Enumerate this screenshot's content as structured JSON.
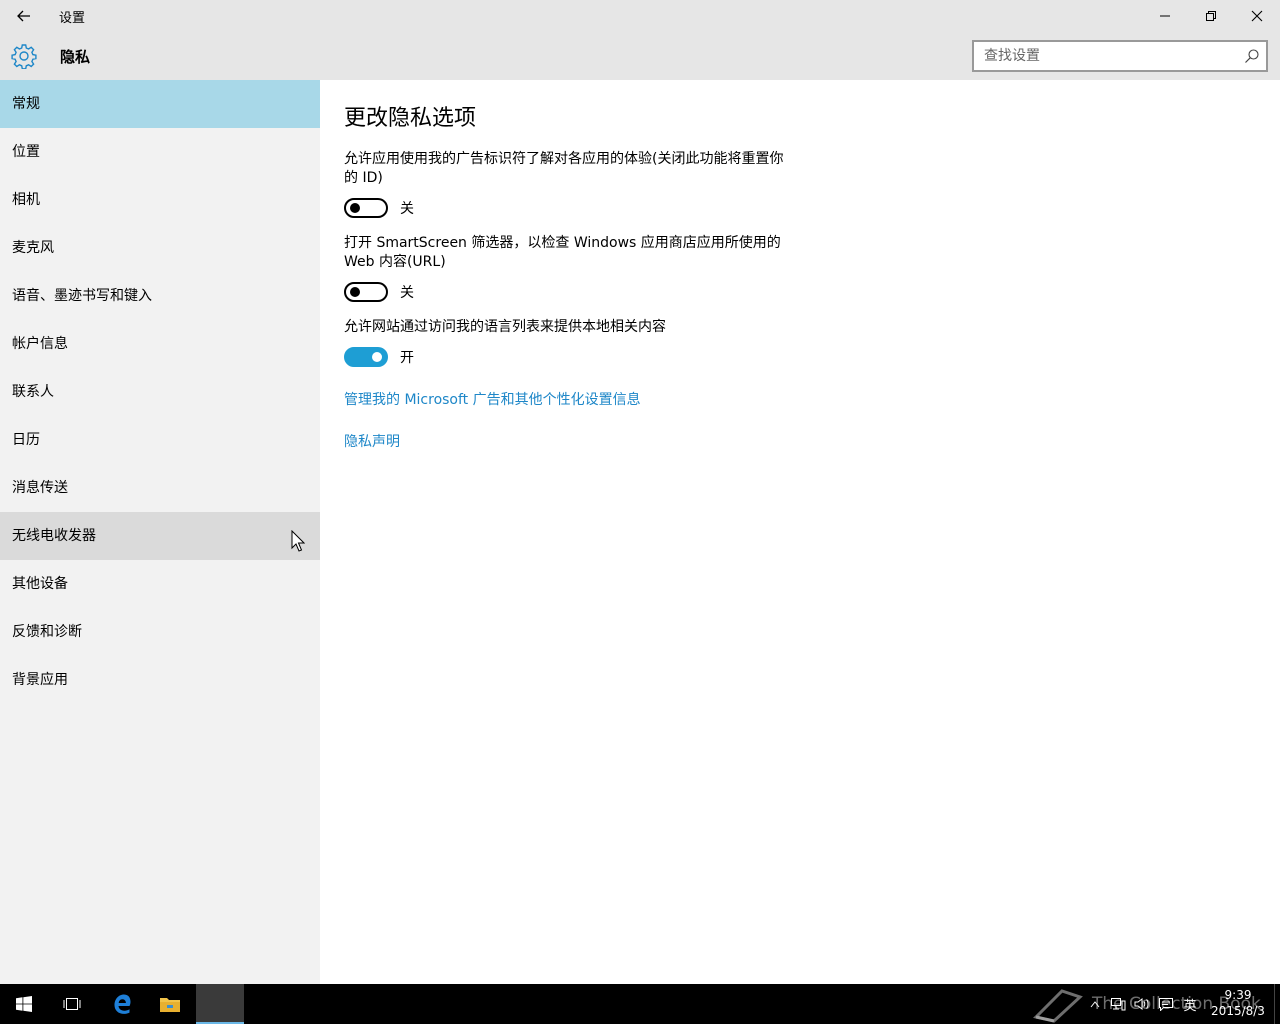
{
  "window": {
    "title": "设置",
    "section": "隐私",
    "search_placeholder": "查找设置"
  },
  "sidebar": {
    "items": [
      {
        "label": "常规"
      },
      {
        "label": "位置"
      },
      {
        "label": "相机"
      },
      {
        "label": "麦克风"
      },
      {
        "label": "语音、墨迹书写和键入"
      },
      {
        "label": "帐户信息"
      },
      {
        "label": "联系人"
      },
      {
        "label": "日历"
      },
      {
        "label": "消息传送"
      },
      {
        "label": "无线电收发器"
      },
      {
        "label": "其他设备"
      },
      {
        "label": "反馈和诊断"
      },
      {
        "label": "背景应用"
      }
    ],
    "active_index": 0,
    "hover_index": 9
  },
  "main": {
    "heading": "更改隐私选项",
    "settings": [
      {
        "label": "允许应用使用我的广告标识符了解对各应用的体验(关闭此功能将重置你的 ID)",
        "state": "关",
        "on": false
      },
      {
        "label": "打开 SmartScreen 筛选器，以检查 Windows 应用商店应用所使用的 Web 内容(URL)",
        "state": "关",
        "on": false
      },
      {
        "label": "允许网站通过访问我的语言列表来提供本地相关内容",
        "state": "开",
        "on": true
      }
    ],
    "links": {
      "manage_ads": "管理我的 Microsoft 广告和其他个性化设置信息",
      "privacy_statement": "隐私声明"
    }
  },
  "colors": {
    "accent": "#1e9ed4",
    "link": "#1e87c8",
    "active_nav": "#a8d8e8",
    "sidebar_bg": "#f2f2f2"
  },
  "taskbar": {
    "ime": "英",
    "time": "9:39",
    "date": "2015/8/3",
    "watermark": "The Collection Book"
  }
}
